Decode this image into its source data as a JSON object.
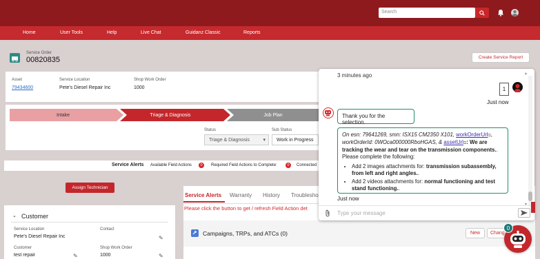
{
  "topbar": {
    "search_placeholder": "Search"
  },
  "nav": {
    "items": [
      "Home",
      "User Tools",
      "Help",
      "Live Chat",
      "Guidanz Classic",
      "Reports"
    ]
  },
  "service_order": {
    "label": "Service Order",
    "number": "00820835",
    "create_report": "Create Service Report"
  },
  "details": {
    "asset_label": "Asset",
    "asset_value": "79434600",
    "location_label": "Service Location",
    "location_value": "Pete's Diesel Repair Inc",
    "work_order_label": "Shop Work Order",
    "work_order_value": "1000"
  },
  "stages": [
    "Intake",
    "Triage & Diagnosis",
    "Job Plan"
  ],
  "status": {
    "status_label": "Status",
    "status_value": "Triage & Diagnosis",
    "sub_status_label": "Sub Status",
    "sub_status_value": "Work in Progress"
  },
  "alerts_bar": {
    "title": "Service Alerts",
    "available": "Available Field Actions",
    "available_count": "0",
    "required": "Required Field Actions to Complete:",
    "required_count": "0",
    "connected": "Connected"
  },
  "assign_button": "Assign Technician",
  "customer_panel": {
    "title": "Customer",
    "location_label": "Service Location",
    "location_value": "Pete's Diesel Repair Inc",
    "contact_label": "Contact",
    "customer_label": "Customer",
    "customer_value": "test repair",
    "work_order_label": "Shop Work Order",
    "work_order_value": "1000"
  },
  "tabs": [
    "Service Alerts",
    "Warranty",
    "History",
    "Troubleshoo"
  ],
  "field_action_msg": "Please click the button to get / refresh Field Action det",
  "campaigns": {
    "title": "Campaigns, TRPs, and ATCs (0)",
    "new": "New",
    "change": "Chang"
  },
  "chat": {
    "time_header": "3 minutes ago",
    "user_message": "1",
    "just_now_1": "Just now",
    "bot_message_1": "Thank you for the selection.",
    "bot_long": {
      "on_esn": "On esn: 79641269, smn: ISX15 CM2350 X101, ",
      "work_order_url": "workOrderUrl",
      "work_order_id": "workOrderId: 0WOcа000000RboHGAS, & ",
      "asset_url": "assetUrl",
      "bold_text": ": We are tracking the wear and tear on the transmission components.",
      "tail": ". Please complete the following:",
      "item1_prefix": "Add 2 images attachments for: ",
      "item1_bold": "transmission subassembly, from left and right angles.",
      "item1_tail": ".",
      "item2_prefix": "Add 2 videos attachments for: ",
      "item2_bold": "normal functioning and test stand functioning.",
      "item2_tail": "."
    },
    "just_now_2": "Just now",
    "input_placeholder": "Type your message",
    "badge_count": "0"
  }
}
